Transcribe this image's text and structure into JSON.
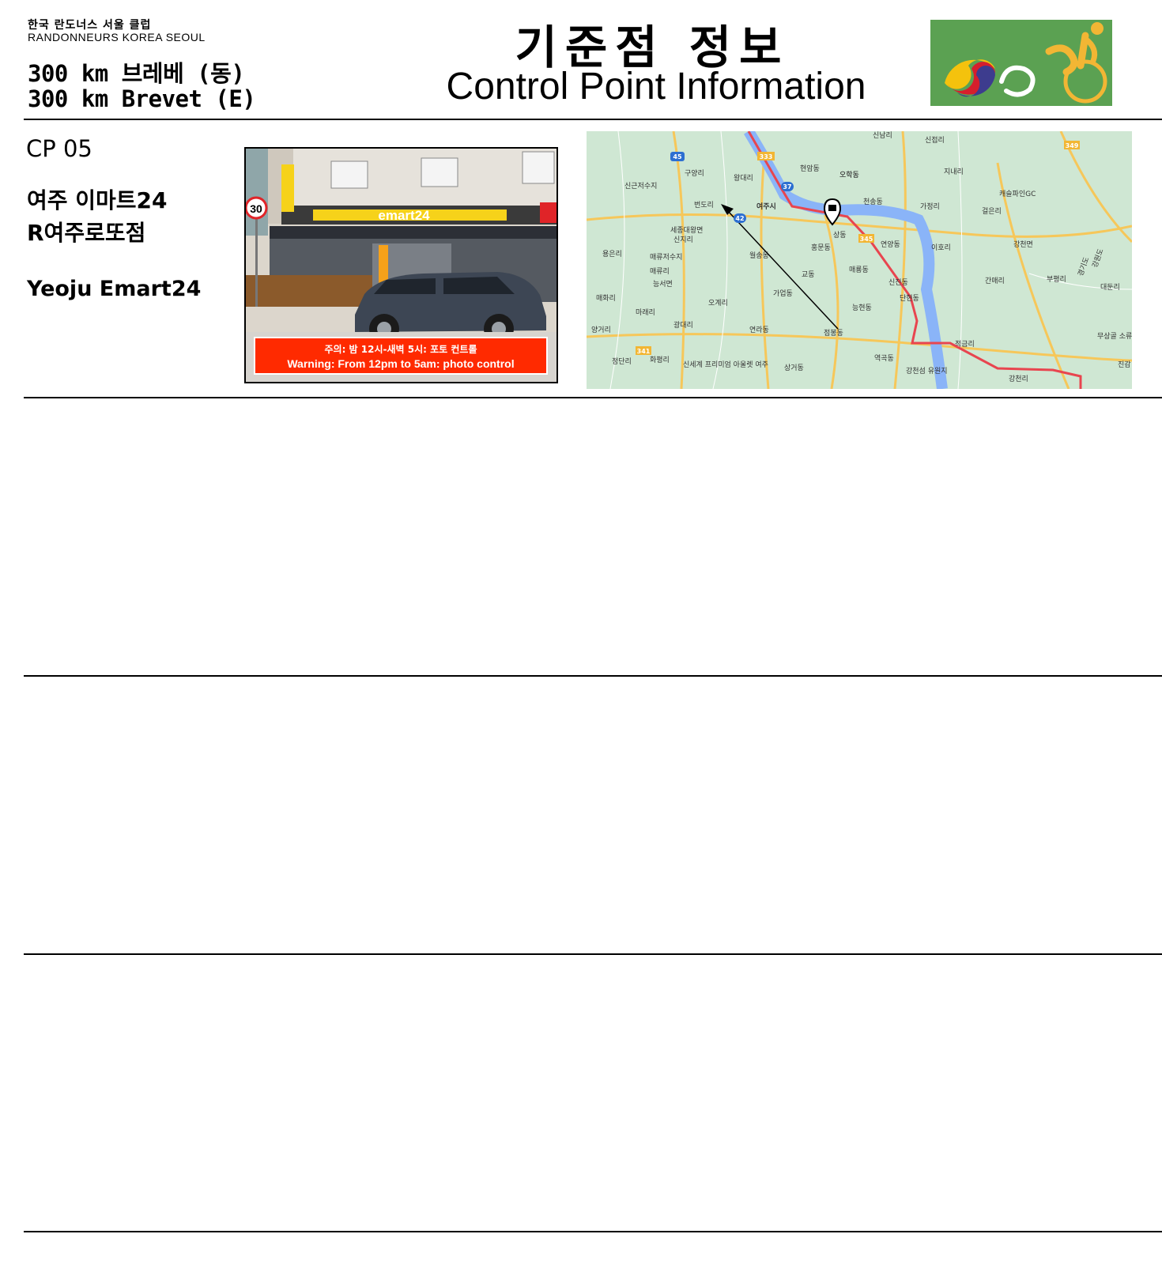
{
  "header": {
    "club_korean": "한국 란도너스 서울 클럽",
    "club_english": "RANDONNEURS KOREA SEOUL",
    "brevet_korean": "300 km 브레베 (동)",
    "brevet_english": "300 km Brevet (E)",
    "title_korean": "기준점 정보",
    "title_english": "Control Point Information",
    "logo_colors": {
      "background": "#5ba152",
      "gold": "#f2b634",
      "red": "#d61e2c",
      "blue": "#3d3c8e",
      "yellow": "#f4c20d"
    }
  },
  "control_point": {
    "number": "CP 05",
    "name_korean_line1": "여주 이마트24",
    "name_korean_line2": "R여주로또점",
    "name_english": "Yeoju Emart24"
  },
  "photo": {
    "store_sign": "emart24",
    "speed_limit": "30",
    "warning_korean": "주의: 밤 12시-새벽 5시: 포토 컨트롤",
    "warning_english": "Warning: From 12pm to 5am: photo control"
  },
  "map": {
    "colors": {
      "land": "#cfe7d3",
      "river": "#8ab4f8",
      "route": "#e8454f",
      "road": "#f6c75a",
      "shield": "#2d6fd1"
    },
    "labels": [
      "여주시",
      "번도리",
      "세종대왕면",
      "신지리",
      "오학동",
      "천송동",
      "연양동",
      "상동",
      "가정리",
      "캐슬파인GC",
      "강천면",
      "이호리",
      "간매리",
      "부평리",
      "매류저수지",
      "매류리",
      "능서면",
      "오계리",
      "가업동",
      "교동",
      "홍문동",
      "단현동",
      "신진동",
      "능현동",
      "점봉동",
      "연라동",
      "광대리",
      "마래리",
      "매화리",
      "양거리",
      "정단리",
      "화평리",
      "신세계 프리미엄 아울렛 여주",
      "상거동",
      "월송동",
      "역곡동",
      "강천섬 유원지",
      "강천리",
      "걸은리",
      "지내리",
      "신접리",
      "신남리",
      "현암동",
      "왕대리",
      "구양리",
      "신근저수지",
      "용은리",
      "매룡동",
      "적금리",
      "오학동",
      "경기도",
      "강원도",
      "무상골 소류지",
      "대둔리",
      "진감"
    ],
    "road_shields": [
      "45",
      "333",
      "37",
      "42",
      "345",
      "349",
      "341"
    ]
  }
}
